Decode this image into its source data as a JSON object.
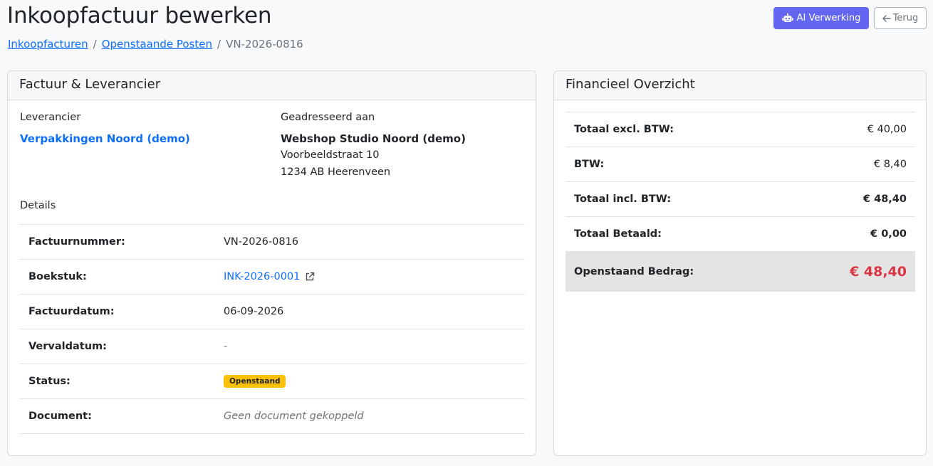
{
  "page": {
    "title": "Inkoopfactuur bewerken",
    "breadcrumb": [
      "Inkoopfacturen",
      "Openstaande Posten",
      "VN-2026-0816"
    ]
  },
  "actions": {
    "ai_label": "AI Verwerking",
    "back_label": "Terug"
  },
  "invoice_card": {
    "title": "Factuur & Leverancier",
    "supplier_label": "Leverancier",
    "supplier_name": "Verpakkingen Noord (demo)",
    "addressed_label": "Geadresseerd aan",
    "addressee_name": "Webshop Studio Noord (demo)",
    "address_line1": "Voorbeeldstraat 10",
    "address_line2": "1234 AB Heerenveen",
    "details_label": "Details",
    "rows": [
      {
        "label": "Factuurnummer:",
        "value": "VN-2026-0816"
      },
      {
        "label": "Boekstuk:",
        "value": "INK-2026-0001"
      },
      {
        "label": "Factuurdatum:",
        "value": "06-09-2026"
      },
      {
        "label": "Vervaldatum:",
        "value": "-"
      },
      {
        "label": "Status:",
        "value": "Openstaand"
      },
      {
        "label": "Document:",
        "value": "Geen document gekoppeld"
      }
    ]
  },
  "financial_card": {
    "title": "Financieel Overzicht",
    "rows": [
      {
        "label": "Totaal excl. BTW:",
        "value": "€ 40,00"
      },
      {
        "label": "BTW:",
        "value": "€ 8,40"
      },
      {
        "label": "Totaal incl. BTW:",
        "value": "€ 48,40"
      },
      {
        "label": "Totaal Betaald:",
        "value": "€ 0,00"
      },
      {
        "label": "Openstaand Bedrag:",
        "value": "€ 48,40"
      }
    ]
  },
  "colors": {
    "primary": "#0d6efd",
    "ai_button": "#6366f1",
    "status_badge": "#ffc107",
    "outstanding_amount": "#dc3545"
  },
  "icons": {
    "ai": "robot-icon",
    "back": "arrow-left-icon",
    "external": "external-link-icon"
  }
}
